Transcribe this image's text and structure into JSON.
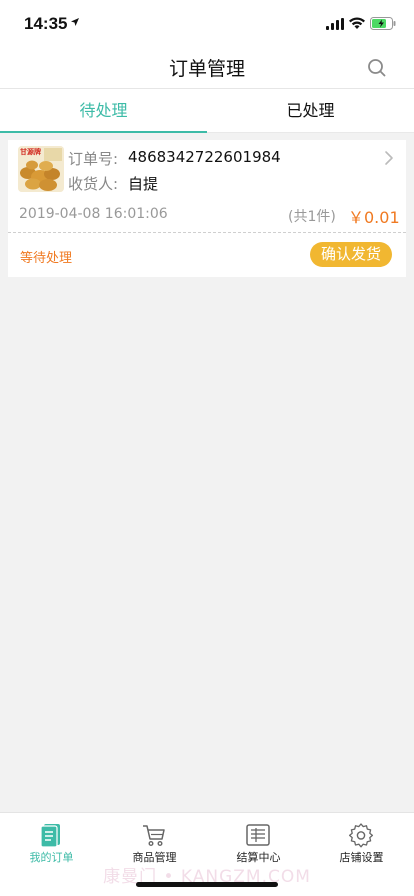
{
  "status_bar": {
    "time": "14:35"
  },
  "nav": {
    "title": "订单管理"
  },
  "tabs": [
    {
      "label": "待处理",
      "active": true
    },
    {
      "label": "已处理",
      "active": false
    }
  ],
  "order": {
    "thumb_brand": "甘源牌",
    "order_no_label": "订单号:",
    "order_no": "4868342722601984",
    "receiver_label": "收货人:",
    "receiver": "自提",
    "time": "2019-04-08 16:01:06",
    "count": "(共1件)",
    "price": "￥0.01",
    "status": "等待处理",
    "action_label": "确认发货"
  },
  "tabbar": {
    "items": [
      {
        "label": "我的订单",
        "icon": "order-icon",
        "active": true
      },
      {
        "label": "商品管理",
        "icon": "cart-icon",
        "active": false
      },
      {
        "label": "结算中心",
        "icon": "settlement-icon",
        "active": false
      },
      {
        "label": "店铺设置",
        "icon": "gear-icon",
        "active": false
      }
    ]
  },
  "watermark": "康曼门 • KANGZM.COM",
  "colors": {
    "accent": "#3dbba7",
    "price": "#f07a22",
    "button": "#f1b731"
  }
}
